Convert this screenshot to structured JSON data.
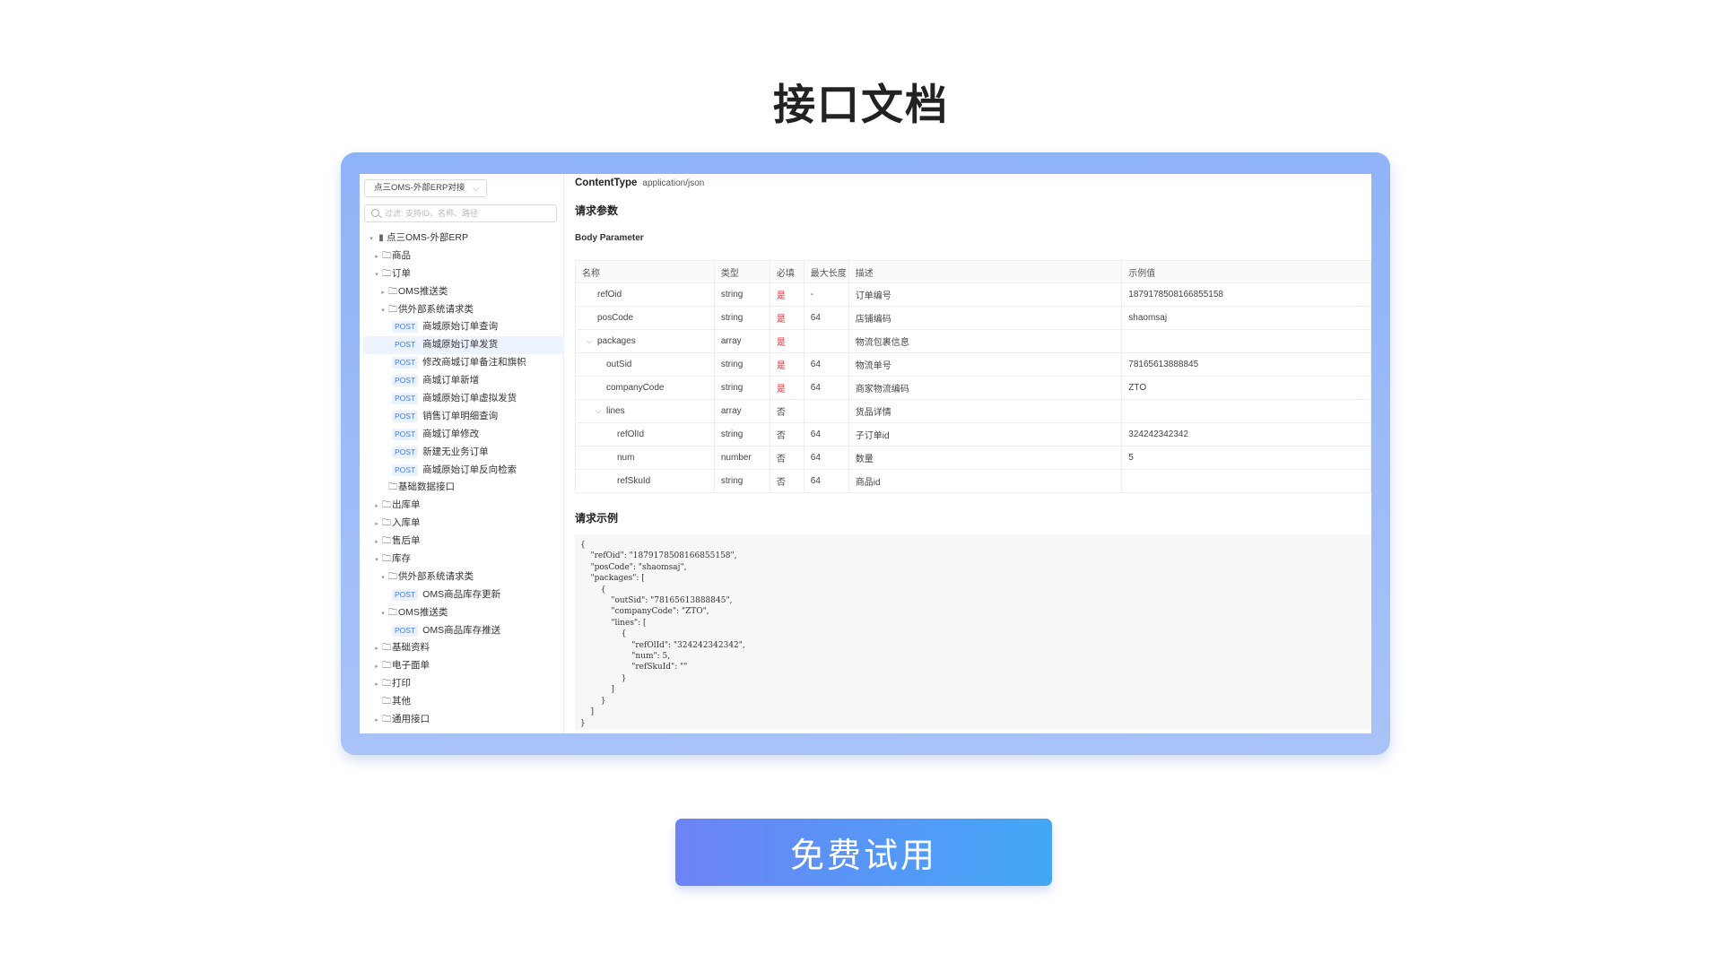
{
  "page_title": "接口文档",
  "cta_label": "免费试用",
  "sidebar": {
    "project_select": "点三OMS-外部ERP对接",
    "search_placeholder": "过滤: 支持ID、名称、路径",
    "tree": [
      {
        "indent": 0,
        "caret": "▾",
        "icon": "▮",
        "label": "点三OMS-外部ERP"
      },
      {
        "indent": 1,
        "caret": "▸",
        "icon": "🗀",
        "label": "商品"
      },
      {
        "indent": 1,
        "caret": "▾",
        "icon": "🗀",
        "label": "订单"
      },
      {
        "indent": 2,
        "caret": "▸",
        "icon": "🗀",
        "label": "OMS推送类"
      },
      {
        "indent": 2,
        "caret": "▾",
        "icon": "🗀",
        "label": "供外部系统请求类"
      },
      {
        "indent": 3,
        "method": "POST",
        "label": "商城原始订单查询"
      },
      {
        "indent": 3,
        "method": "POST",
        "label": "商城原始订单发货",
        "selected": true
      },
      {
        "indent": 3,
        "method": "POST",
        "label": "修改商城订单备注和旗帜"
      },
      {
        "indent": 3,
        "method": "POST",
        "label": "商城订单新增"
      },
      {
        "indent": 3,
        "method": "POST",
        "label": "商城原始订单虚拟发货"
      },
      {
        "indent": 3,
        "method": "POST",
        "label": "销售订单明细查询"
      },
      {
        "indent": 3,
        "method": "POST",
        "label": "商城订单修改"
      },
      {
        "indent": 3,
        "method": "POST",
        "label": "新建无业务订单"
      },
      {
        "indent": 3,
        "method": "POST",
        "label": "商城原始订单反向检索"
      },
      {
        "indent": 2,
        "caret": "",
        "icon": "🗀",
        "label": "基础数据接口"
      },
      {
        "indent": 1,
        "caret": "▸",
        "icon": "🗀",
        "label": "出库单"
      },
      {
        "indent": 1,
        "caret": "▸",
        "icon": "🗀",
        "label": "入库单"
      },
      {
        "indent": 1,
        "caret": "▸",
        "icon": "🗀",
        "label": "售后单"
      },
      {
        "indent": 1,
        "caret": "▾",
        "icon": "🗀",
        "label": "库存"
      },
      {
        "indent": 2,
        "caret": "▾",
        "icon": "🗀",
        "label": "供外部系统请求类"
      },
      {
        "indent": 3,
        "method": "POST",
        "label": "OMS商品库存更新"
      },
      {
        "indent": 2,
        "caret": "▾",
        "icon": "🗀",
        "label": "OMS推送类"
      },
      {
        "indent": 3,
        "method": "POST",
        "label": "OMS商品库存推送"
      },
      {
        "indent": 1,
        "caret": "▸",
        "icon": "🗀",
        "label": "基础资料"
      },
      {
        "indent": 1,
        "caret": "▸",
        "icon": "🗀",
        "label": "电子面单"
      },
      {
        "indent": 1,
        "caret": "▸",
        "icon": "🗀",
        "label": "打印"
      },
      {
        "indent": 1,
        "caret": "",
        "icon": "🗀",
        "label": "其他"
      },
      {
        "indent": 1,
        "caret": "▸",
        "icon": "🗀",
        "label": "通用接口"
      }
    ]
  },
  "main": {
    "content_type_label": "ContentType",
    "content_type_value": "application/json",
    "request_params_title": "请求参数",
    "body_param_title": "Body Parameter",
    "table": {
      "headers": [
        "名称",
        "类型",
        "必填",
        "最大长度",
        "描述",
        "示例值"
      ],
      "rows": [
        {
          "level": 1,
          "caret": "",
          "name": "refOid",
          "type": "string",
          "required": "是",
          "max_len": "-",
          "desc": "订单编号",
          "example": "1879178508166855158"
        },
        {
          "level": 1,
          "caret": "",
          "name": "posCode",
          "type": "string",
          "required": "是",
          "max_len": "64",
          "desc": "店铺编码",
          "example": "shaomsaj"
        },
        {
          "level": 1,
          "caret": "⌵",
          "name": "packages",
          "type": "array",
          "required": "是",
          "max_len": "",
          "desc": "物流包裹信息",
          "example": ""
        },
        {
          "level": 2,
          "caret": "",
          "name": "outSid",
          "type": "string",
          "required": "是",
          "max_len": "64",
          "desc": "物流单号",
          "example": "78165613888845"
        },
        {
          "level": 2,
          "caret": "",
          "name": "companyCode",
          "type": "string",
          "required": "是",
          "max_len": "64",
          "desc": "商家物流编码",
          "example": "ZTO"
        },
        {
          "level": 2,
          "caret": "⌵",
          "name": "lines",
          "type": "array",
          "required": "否",
          "max_len": "",
          "desc": "货品详情",
          "example": ""
        },
        {
          "level": 3,
          "caret": "",
          "name": "refOlId",
          "type": "string",
          "required": "否",
          "max_len": "64",
          "desc": "子订单id",
          "example": "324242342342"
        },
        {
          "level": 3,
          "caret": "",
          "name": "num",
          "type": "number",
          "required": "否",
          "max_len": "64",
          "desc": "数量",
          "example": "5"
        },
        {
          "level": 3,
          "caret": "",
          "name": "refSkuId",
          "type": "string",
          "required": "否",
          "max_len": "64",
          "desc": "商品id",
          "example": ""
        }
      ]
    },
    "request_example_title": "请求示例",
    "request_example_code": "{\n    \"refOid\": \"1879178508166855158\",\n    \"posCode\": \"shaomsaj\",\n    \"packages\": [\n        {\n            \"outSid\": \"78165613888845\",\n            \"companyCode\": \"ZTO\",\n            \"lines\": [\n                {\n                    \"refOlId\": \"324242342342\",\n                    \"num\": 5,\n                    \"refSkuId\": \"\"\n                }\n            ]\n        }\n    ]\n}"
  }
}
